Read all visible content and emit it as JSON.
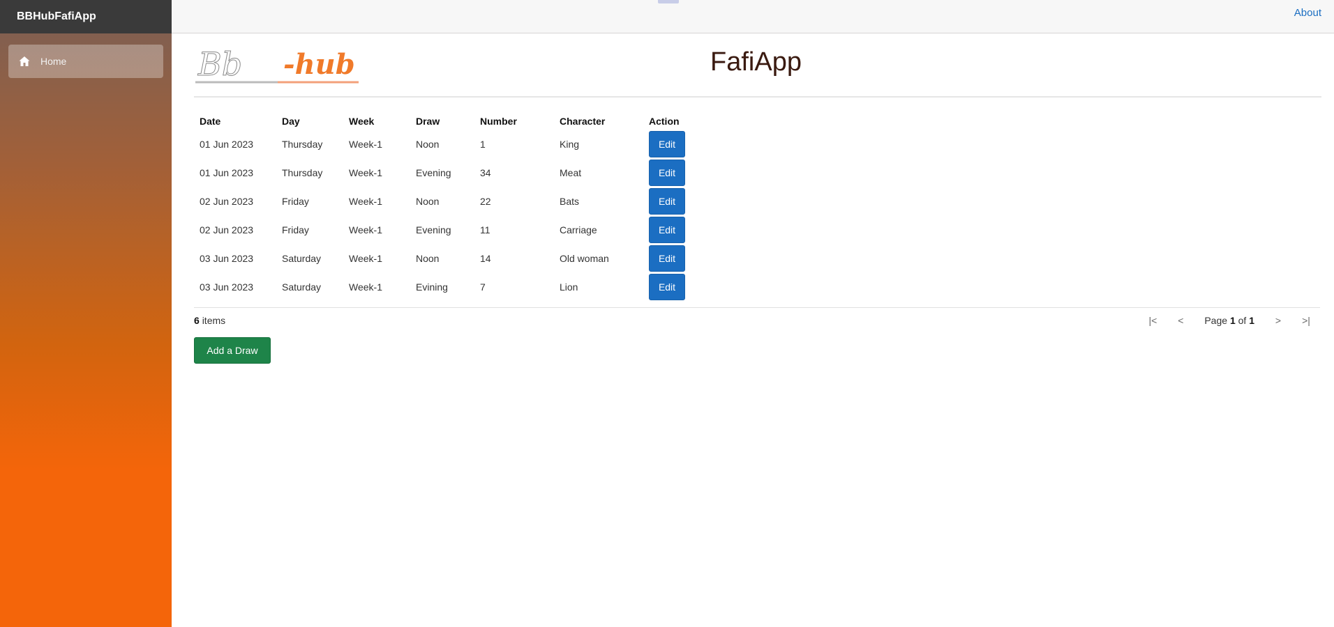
{
  "sidebar": {
    "brand": "BBHubFafiApp",
    "items": [
      {
        "label": "Home",
        "icon": "home-icon",
        "active": true
      }
    ]
  },
  "topbar": {
    "about_label": "About"
  },
  "header": {
    "title": "FafiApp",
    "logo_text": "Bb-hub"
  },
  "table": {
    "columns": [
      "Date",
      "Day",
      "Week",
      "Draw",
      "Number",
      "Character",
      "Action"
    ],
    "rows": [
      {
        "date": "01 Jun 2023",
        "day": "Thursday",
        "week": "Week-1",
        "draw": "Noon",
        "number": "1",
        "character": "King",
        "action": "Edit"
      },
      {
        "date": "01 Jun 2023",
        "day": "Thursday",
        "week": "Week-1",
        "draw": "Evening",
        "number": "34",
        "character": "Meat",
        "action": "Edit"
      },
      {
        "date": "02 Jun 2023",
        "day": "Friday",
        "week": "Week-1",
        "draw": "Noon",
        "number": "22",
        "character": "Bats",
        "action": "Edit"
      },
      {
        "date": "02 Jun 2023",
        "day": "Friday",
        "week": "Week-1",
        "draw": "Evening",
        "number": "11",
        "character": "Carriage",
        "action": "Edit"
      },
      {
        "date": "03 Jun 2023",
        "day": "Saturday",
        "week": "Week-1",
        "draw": "Noon",
        "number": "14",
        "character": "Old woman",
        "action": "Edit"
      },
      {
        "date": "03 Jun 2023",
        "day": "Saturday",
        "week": "Week-1",
        "draw": "Evining",
        "number": "7",
        "character": "Lion",
        "action": "Edit"
      }
    ]
  },
  "pager": {
    "item_count": "6",
    "items_label": "items",
    "page_prefix": "Page",
    "current_page": "1",
    "of_label": "of",
    "total_pages": "1",
    "first": "|<",
    "prev": "<",
    "next": ">",
    "last": ">|"
  },
  "actions": {
    "add_label": "Add a Draw"
  },
  "colors": {
    "primary": "#1b6ec2",
    "success": "#1e8449",
    "sidebar_top": "#7a5f55",
    "sidebar_bottom": "#f4650a"
  }
}
